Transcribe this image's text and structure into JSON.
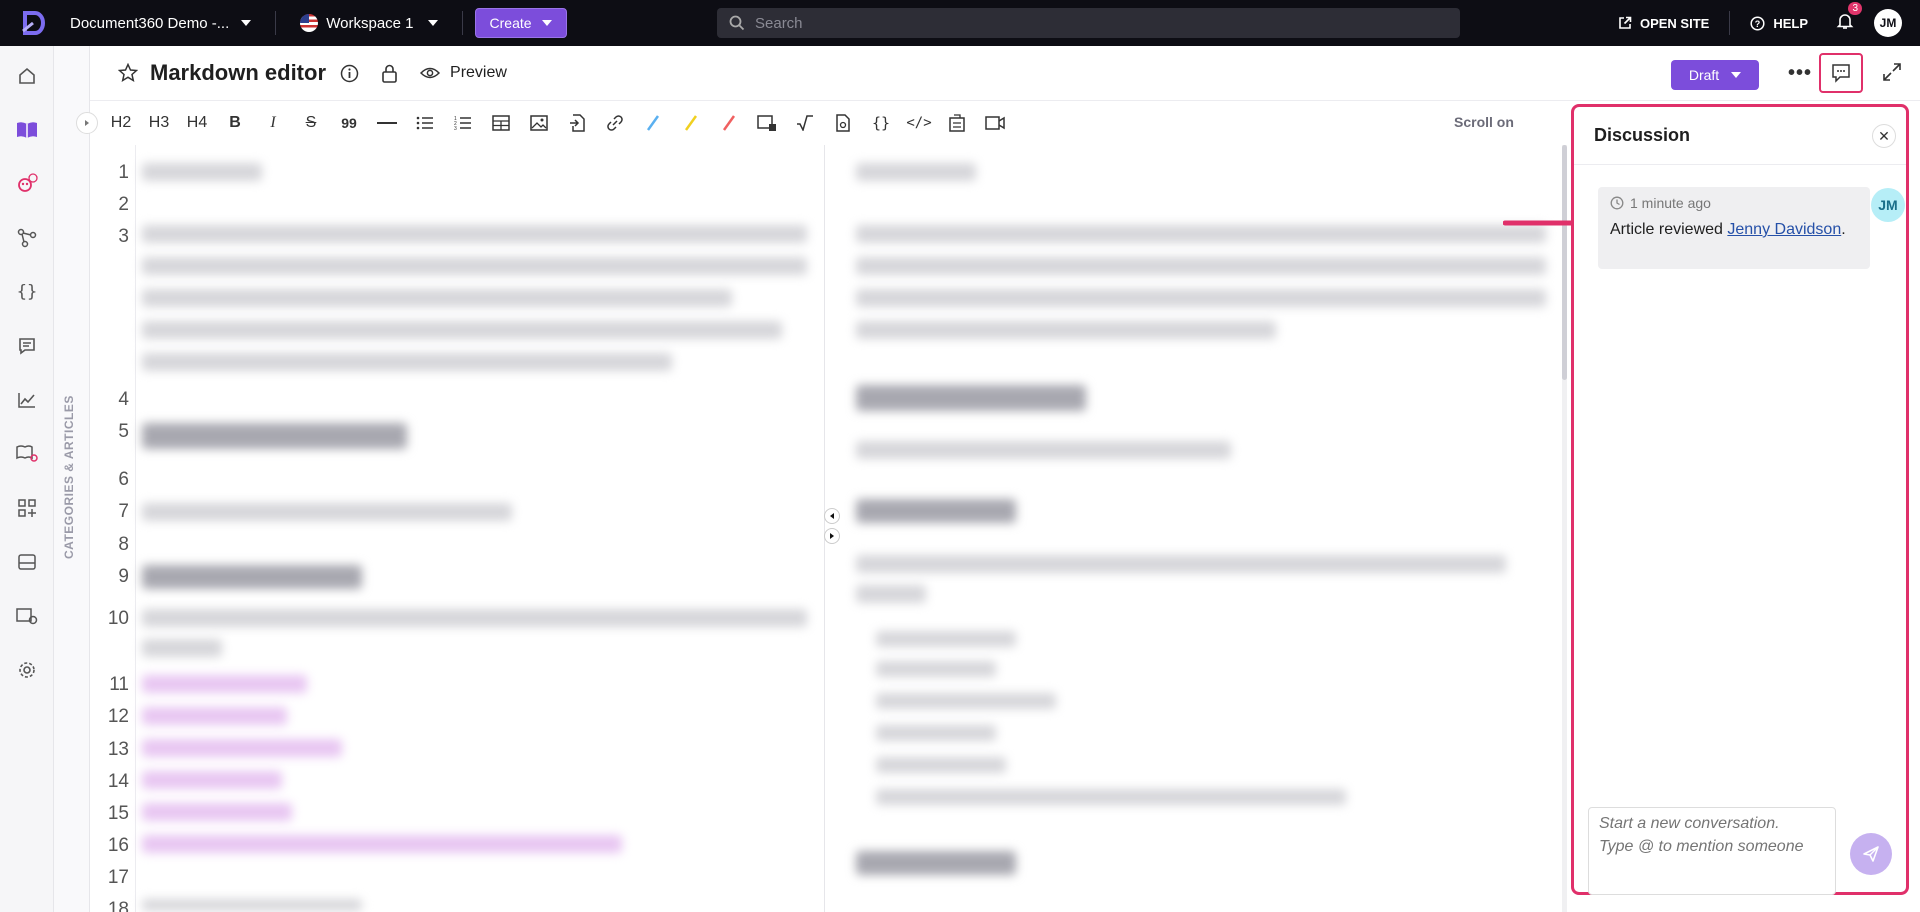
{
  "topbar": {
    "project_name": "Document360 Demo -...",
    "workspace": "Workspace 1",
    "create_label": "Create",
    "search_placeholder": "Search",
    "open_site_label": "OPEN SITE",
    "help_label": "HELP",
    "notification_count": "3",
    "user_initials": "JM"
  },
  "nav": {
    "items": [
      "home-icon",
      "book-icon",
      "robot-icon",
      "network-icon",
      "braces-icon",
      "chat-icon",
      "analytics-icon",
      "book-settings-icon",
      "apps-icon",
      "layout-icon",
      "drive-icon",
      "settings-icon"
    ],
    "categories_label": "CATEGORIES & ARTICLES"
  },
  "article": {
    "title": "Markdown editor",
    "preview_label": "Preview",
    "status_label": "Draft"
  },
  "toolbar": {
    "items": [
      "H2",
      "H3",
      "H4",
      "B",
      "I",
      "S",
      "99"
    ],
    "scroll_label": "Scroll on"
  },
  "editor": {
    "line_numbers": [
      "1",
      "2",
      "3",
      "4",
      "5",
      "6",
      "7",
      "8",
      "9",
      "10",
      "11",
      "12",
      "13",
      "14",
      "15",
      "16",
      "17",
      "18"
    ]
  },
  "discussion": {
    "title": "Discussion",
    "comment_time": "1 minute ago",
    "comment_prefix": "Article reviewed ",
    "comment_user": "Jenny Davidson",
    "comment_suffix": ".",
    "commenter_initials": "JM",
    "input_placeholder": "Start a new conversation.\nType @ to mention someone"
  },
  "colors": {
    "topbar_bg": "#0d0d14",
    "accent": "#7c4ddb",
    "highlight": "#e0306a"
  }
}
